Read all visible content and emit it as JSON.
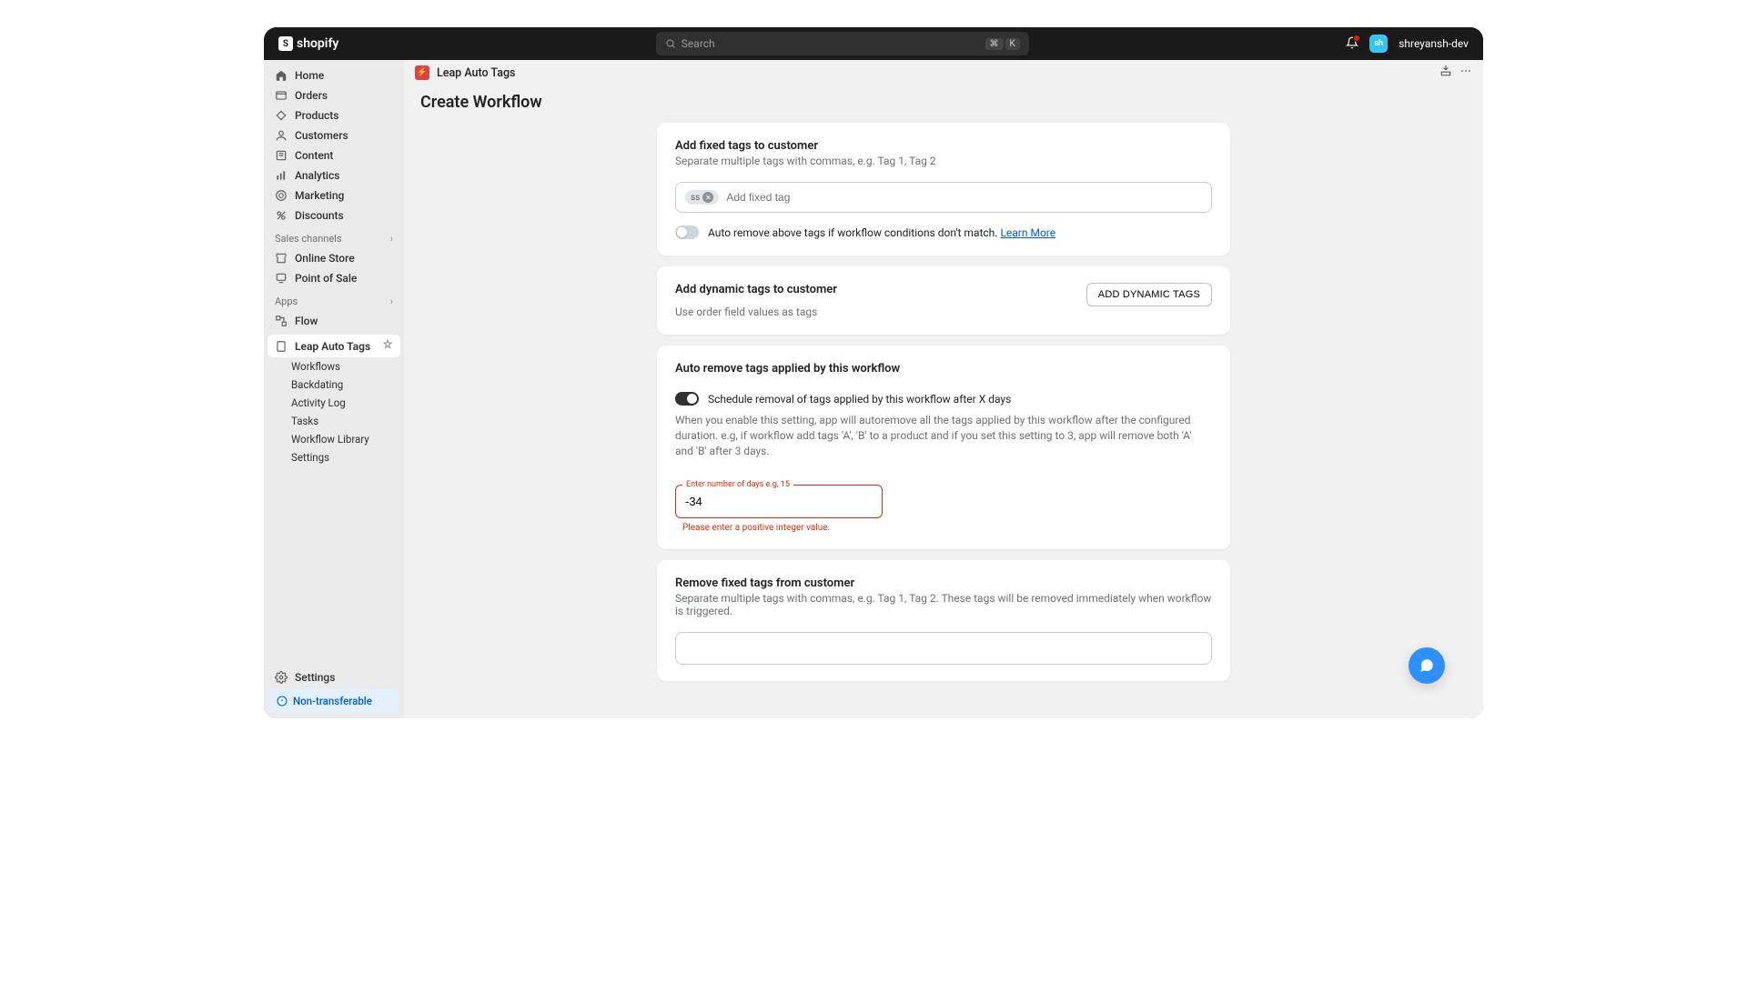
{
  "topbar": {
    "brand": "shopify",
    "search_placeholder": "Search",
    "kbd1": "⌘",
    "kbd2": "K",
    "user_initials": "sh",
    "username": "shreyansh-dev"
  },
  "sidebar": {
    "main": [
      "Home",
      "Orders",
      "Products",
      "Customers",
      "Content",
      "Analytics",
      "Marketing",
      "Discounts"
    ],
    "sales_channels_label": "Sales channels",
    "sales_channels": [
      "Online Store",
      "Point of Sale"
    ],
    "apps_label": "Apps",
    "apps": [
      "Flow"
    ],
    "active_app": "Leap Auto Tags",
    "app_sub": [
      "Workflows",
      "Backdating",
      "Activity Log",
      "Tasks",
      "Workflow Library",
      "Settings"
    ],
    "settings": "Settings",
    "non_transferable": "Non-transferable"
  },
  "app_header": {
    "app_name": "Leap Auto Tags"
  },
  "page": {
    "title": "Create Workflow"
  },
  "cards": {
    "fixed": {
      "title": "Add fixed tags to customer",
      "sub": "Separate multiple tags with commas, e.g. Tag 1, Tag 2",
      "existing_tag": "ss",
      "placeholder": "Add fixed tag",
      "toggle_text": "Auto remove above tags if workflow conditions don't match. ",
      "learn_more": "Learn More"
    },
    "dynamic": {
      "title": "Add dynamic tags to customer",
      "sub": "Use order field values as tags",
      "btn": "ADD DYNAMIC TAGS"
    },
    "autoremove": {
      "title": "Auto remove tags applied by this workflow",
      "toggle_text": "Schedule removal of tags applied by this workflow after X days",
      "desc": "When you enable this setting, app will autoremove all the tags applied by this workflow after the configured duration. e.g, if workflow add tags 'A', 'B' to a product and if you set this setting to 3, app will remove both 'A' and 'B' after 3 days.",
      "field_label": "Enter number of days e.g, 15",
      "value": "-34",
      "error": "Please enter a positive integer value."
    },
    "remove_fixed": {
      "title": "Remove fixed tags from customer",
      "sub": "Separate multiple tags with commas, e.g. Tag 1, Tag 2. These tags will be removed immediately when workflow is triggered."
    }
  }
}
